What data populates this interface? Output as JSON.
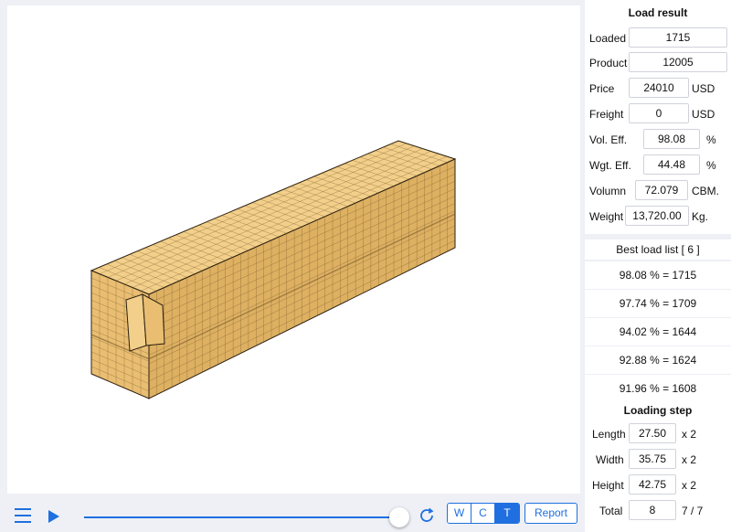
{
  "load_result": {
    "title": "Load result",
    "loaded": {
      "label": "Loaded",
      "value": "1715"
    },
    "product": {
      "label": "Product",
      "value": "12005"
    },
    "price": {
      "label": "Price",
      "value": "24010",
      "unit": "USD"
    },
    "freight": {
      "label": "Freight",
      "value": "0",
      "unit": "USD"
    },
    "vol_eff": {
      "label": "Vol. Eff.",
      "value": "98.08",
      "unit": "%"
    },
    "wgt_eff": {
      "label": "Wgt. Eff.",
      "value": "44.48",
      "unit": "%"
    },
    "volumn": {
      "label": "Volumn",
      "value": "72.079",
      "unit": "CBM."
    },
    "weight": {
      "label": "Weight",
      "value": "13,720.00",
      "unit": "Kg."
    }
  },
  "best_load_list": {
    "header": "Best load list [ 6 ]",
    "items": [
      "98.08 % = 1715",
      "97.74 % = 1709",
      "94.02 % = 1644",
      "92.88 % = 1624",
      "91.96 % = 1608"
    ]
  },
  "loading_step": {
    "title": "Loading step",
    "length": {
      "label": "Length",
      "value": "27.50",
      "mult": "x 2"
    },
    "width": {
      "label": "Width",
      "value": "35.75",
      "mult": "x 2"
    },
    "height": {
      "label": "Height",
      "value": "42.75",
      "mult": "x 2"
    },
    "total": {
      "label": "Total",
      "value": "8",
      "step": "7 / 7"
    }
  },
  "toolbar": {
    "view_w": "W",
    "view_c": "C",
    "view_t": "T",
    "active_view": "T",
    "report_label": "Report",
    "progress": 1.0
  },
  "colors": {
    "accent": "#1f6fe0",
    "cargo_top": "#f2cf8a",
    "cargo_front": "#e9be72",
    "cargo_side": "#ddb062",
    "grid_line": "#7a5a2a"
  },
  "icons": {
    "menu": "menu-icon",
    "play": "play-icon",
    "refresh": "refresh-icon"
  }
}
